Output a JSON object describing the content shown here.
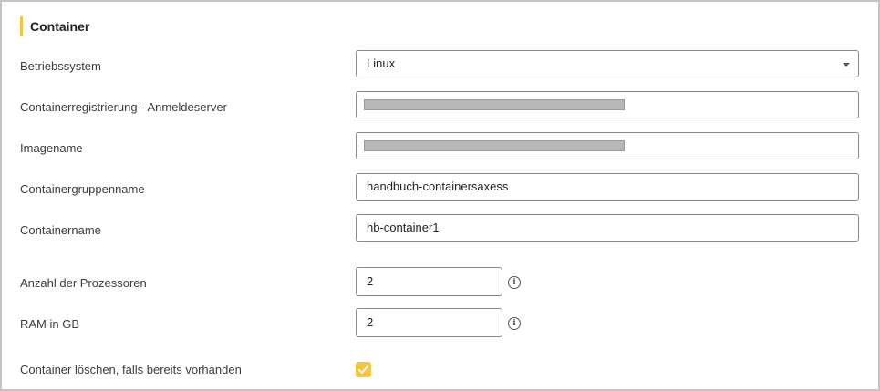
{
  "section": {
    "title": "Container"
  },
  "fields": {
    "os": {
      "label": "Betriebssystem",
      "value": "Linux"
    },
    "registry": {
      "label": "Containerregistrierung - Anmeldeserver"
    },
    "image": {
      "label": "Imagename"
    },
    "group": {
      "label": "Containergruppenname",
      "value": "handbuch-containersaxess"
    },
    "container": {
      "label": "Containername",
      "value": "hb-container1"
    },
    "cpu": {
      "label": "Anzahl der Prozessoren",
      "value": "2"
    },
    "ram": {
      "label": "RAM in GB",
      "value": "2"
    },
    "delete": {
      "label": "Container löschen, falls bereits vorhanden",
      "checked": true
    }
  },
  "colors": {
    "accent": "#f6c343",
    "border": "#8a8a8a",
    "redacted": "#b8b8b8"
  },
  "icons": {
    "dropdown": "chevron-down-icon",
    "info": "info-icon",
    "check": "check-icon"
  }
}
